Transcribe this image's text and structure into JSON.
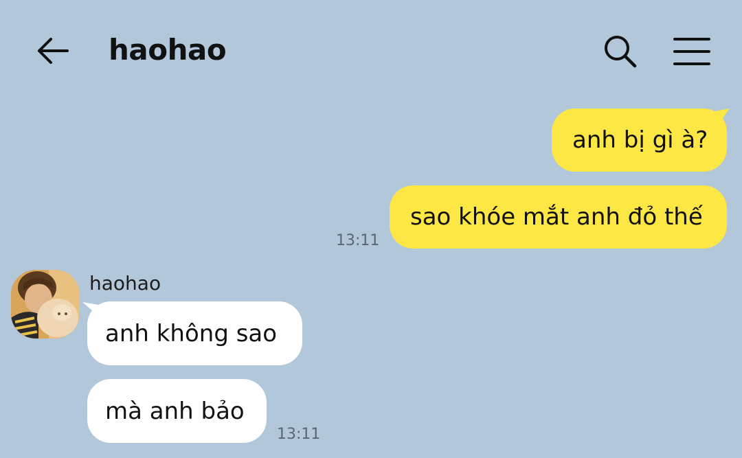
{
  "header": {
    "title": "haohao",
    "back_icon": "arrow-left-icon",
    "search_icon": "search-icon",
    "menu_icon": "hamburger-menu-icon"
  },
  "colors": {
    "background": "#b2c7da",
    "outgoing_bubble": "#fde744",
    "incoming_bubble": "#ffffff",
    "timestamp": "#5b6670"
  },
  "messages": {
    "outgoing": [
      {
        "text": "anh bị gì à?"
      },
      {
        "text": "sao khóe mắt anh đỏ thế"
      }
    ],
    "outgoing_time": "13:11",
    "incoming_sender": "haohao",
    "incoming": [
      {
        "text": "anh không sao"
      },
      {
        "text": "mà anh bảo"
      }
    ],
    "incoming_time": "13:11"
  }
}
